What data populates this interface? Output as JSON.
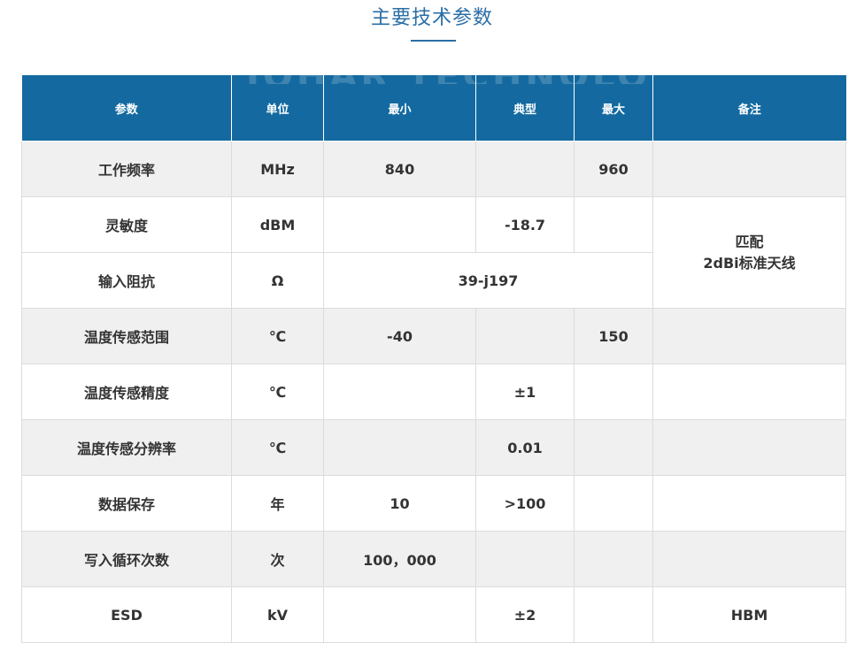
{
  "page": {
    "title": "主要技术参数",
    "watermark": "JOHAR TECHNOLOGY"
  },
  "table": {
    "headers": [
      "参数",
      "单位",
      "最小",
      "典型",
      "最大",
      "备注"
    ],
    "rows": [
      {
        "param": "工作频率",
        "unit": "MHz",
        "min": "840",
        "typ": "",
        "max": "960",
        "note": ""
      },
      {
        "param": "灵敏度",
        "unit": "dBM",
        "min": "",
        "typ": "-18.7",
        "max": "",
        "note_lines": [
          "匹配",
          "2dBi标准天线"
        ]
      },
      {
        "param": "输入阻抗",
        "unit": "Ω",
        "value": "39-j197"
      },
      {
        "param": "温度传感范围",
        "unit": "℃",
        "min": "-40",
        "typ": "",
        "max": "150",
        "note": ""
      },
      {
        "param": "温度传感精度",
        "unit": "℃",
        "min": "",
        "typ": "±1",
        "max": "",
        "note": ""
      },
      {
        "param": "温度传感分辨率",
        "unit": "℃",
        "min": "",
        "typ": "0.01",
        "max": "",
        "note": ""
      },
      {
        "param": "数据保存",
        "unit": "年",
        "min": "10",
        "typ": ">100",
        "max": "",
        "note": ""
      },
      {
        "param": "写入循环次数",
        "unit": "次",
        "min": "100，000",
        "typ": "",
        "max": "",
        "note": ""
      },
      {
        "param": "ESD",
        "unit": "kV",
        "min": "",
        "typ": "±2",
        "max": "",
        "note": "HBM"
      }
    ]
  }
}
